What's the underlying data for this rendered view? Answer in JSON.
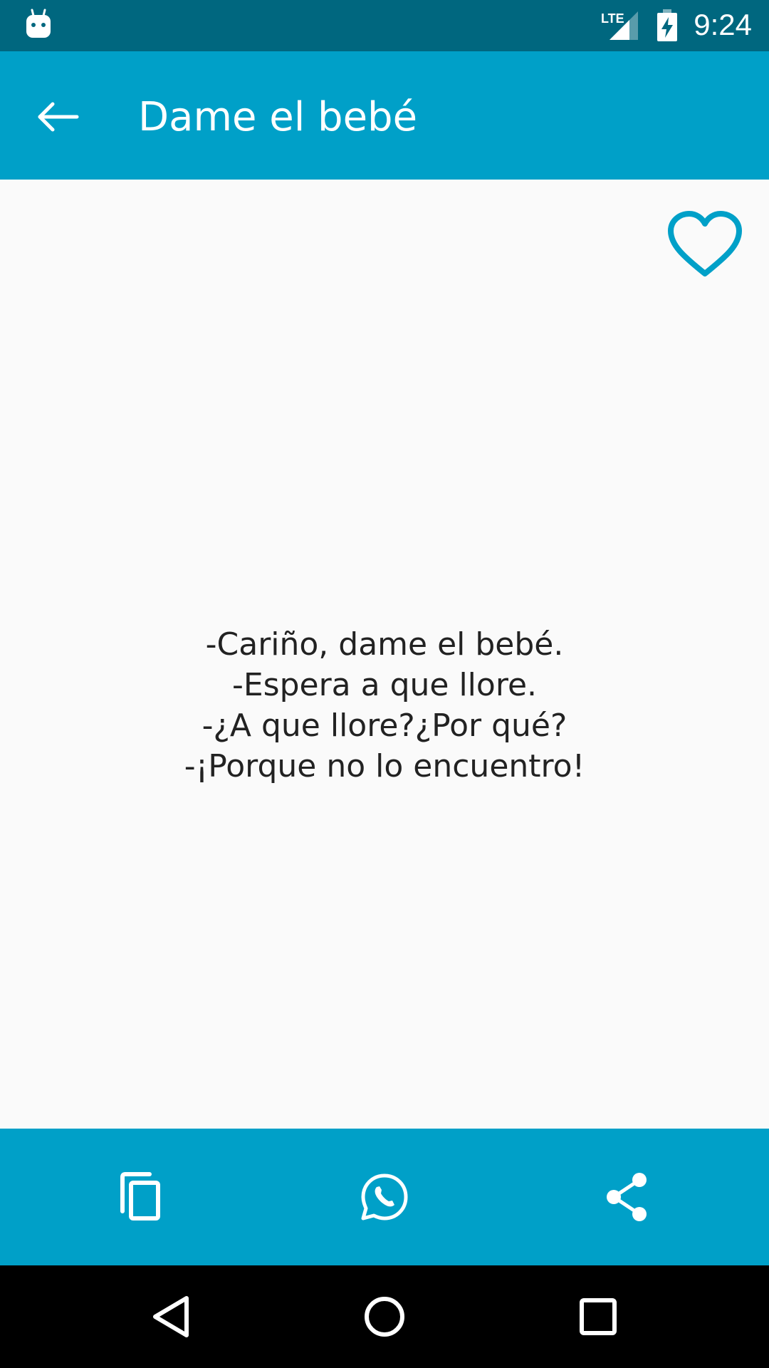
{
  "status_bar": {
    "time": "9:24",
    "network_label": "LTE",
    "icons": [
      "android-notification-icon",
      "lte-signal-icon",
      "battery-charging-icon"
    ]
  },
  "app_bar": {
    "title": "Dame el bebé",
    "back_icon": "arrow-back-icon"
  },
  "content": {
    "favorite_icon": "heart-outline-icon",
    "joke_lines": [
      "-Cariño, dame el bebé.",
      "-Espera a que llore.",
      "-¿A que llore?¿Por qué?",
      "-¡Porque no lo encuentro!"
    ]
  },
  "bottom_actions": {
    "icons": [
      "copy-icon",
      "whatsapp-icon",
      "share-icon"
    ]
  },
  "nav_bar": {
    "icons": [
      "back-triangle-icon",
      "home-circle-icon",
      "recents-square-icon"
    ]
  },
  "colors": {
    "status_bar": "#00677F",
    "primary": "#00A0C8",
    "background": "#FAFAFA",
    "text": "#222222",
    "nav_bar": "#000000"
  }
}
